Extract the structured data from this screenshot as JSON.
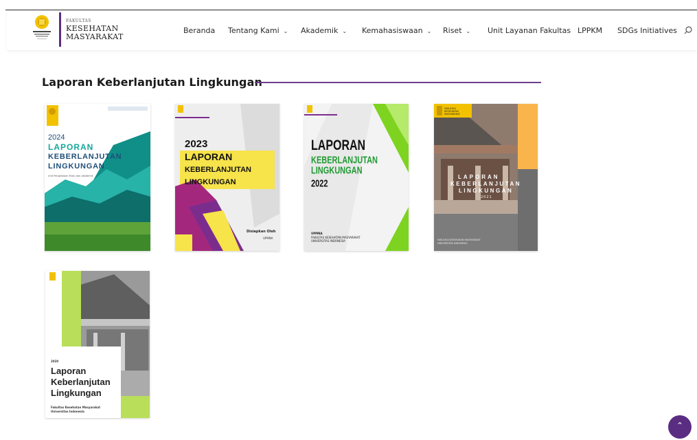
{
  "header": {
    "faculty_small": "FAKULTAS",
    "faculty_line1": "KESEHATAN",
    "faculty_line2": "MASYARAKAT",
    "nav": [
      {
        "label": "Beranda",
        "dropdown": false
      },
      {
        "label": "Tentang Kami",
        "dropdown": true
      },
      {
        "label": "Akademik",
        "dropdown": true
      },
      {
        "label": "Kemahasiswaan",
        "dropdown": true
      },
      {
        "label": "Riset",
        "dropdown": true
      },
      {
        "label": "Unit Layanan Fakultas",
        "dropdown": false
      },
      {
        "label": "LPPKM",
        "dropdown": false
      },
      {
        "label": "SDGs Initiatives",
        "dropdown": false
      }
    ],
    "search_icon": "search-icon"
  },
  "section": {
    "title": "Laporan Keberlanjutan Lingkungan",
    "accent": "#6b3d8c"
  },
  "reports": [
    {
      "year": "2024",
      "l1": "LAPORAN",
      "l2": "KEBERLANJUTAN",
      "l3": "LINGKUNGAN",
      "sub": "Unit Pengelolaan Mutu dan Akademik"
    },
    {
      "year": "2023",
      "l1": "LAPORAN",
      "l2": "KEBERLANJUTAN",
      "l3": "LINGKUNGAN",
      "sub": "Disiapkan Oleh",
      "sub2": "UPMNA"
    },
    {
      "year": "2022",
      "l1": "LAPORAN",
      "l2": "KEBERLANJUTAN",
      "l3": "LINGKUNGAN",
      "sub": "UPMNA",
      "sub2": "FAKULTAS KESEHATAN MASYARAKAT",
      "sub3": "UNIVERSITAS INDONESIA"
    },
    {
      "year": "2021",
      "l1": "LAPORAN",
      "l2": "KEBERLANJUTAN",
      "l3": "LINGKUNGAN",
      "sub": "FAKULTAS KESEHATAN MASYARAKAT",
      "sub2": "UNIVERSITAS INDONESIA",
      "badge1": "FAKULTAS",
      "badge2": "KESEHATAN",
      "badge3": "MASYARAKAT"
    },
    {
      "year": "2020",
      "l1": "Laporan",
      "l2": "Keberlanjutan",
      "l3": "Lingkungan",
      "sub": "Fakultas Kesehatan Masyarakat",
      "sub2": "Universitas Indonesia"
    }
  ],
  "back_to_top_icon": "chevron-up-icon",
  "colors": {
    "purple": "#5a2d82",
    "teal": "#1aa39a",
    "yellow": "#f3e03b",
    "green": "#7ed321",
    "gold": "#f2c200",
    "orange": "#f9b54c"
  }
}
